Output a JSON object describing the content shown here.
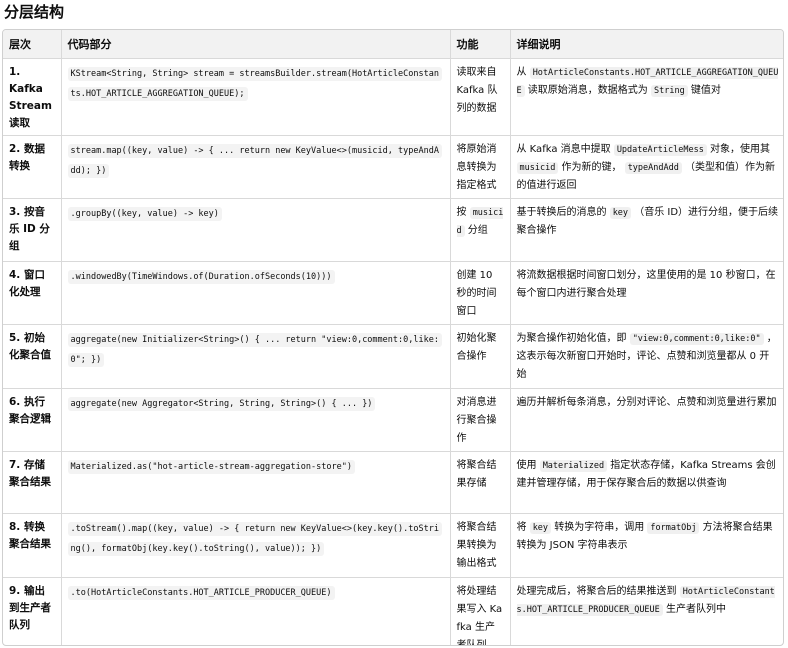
{
  "title": "分层结构",
  "headers": [
    "层次",
    "代码部分",
    "功能",
    "详细说明"
  ],
  "rows": [
    {
      "layer": "1. Kafka Stream 读取",
      "code": "KStream<String, String> stream = streamsBuilder.stream(HotArticleConstants.HOT_ARTICLE_AGGREGATION_QUEUE);",
      "func": "读取来自 Kafka 队列的数据",
      "detail": [
        {
          "t": "text",
          "v": "从 "
        },
        {
          "t": "code",
          "v": "HotArticleConstants.HOT_ARTICLE_AGGREGATION_QUEUE"
        },
        {
          "t": "text",
          "v": " 读取原始消息，数据格式为 "
        },
        {
          "t": "code",
          "v": "String"
        },
        {
          "t": "text",
          "v": " 键值对"
        }
      ]
    },
    {
      "layer": "2. 数据转换",
      "code": "stream.map((key, value) -> { ... return new KeyValue<>(musicid, typeAndAdd); })",
      "func": "将原始消息转换为指定格式",
      "detail": [
        {
          "t": "text",
          "v": "从 Kafka 消息中提取 "
        },
        {
          "t": "code",
          "v": "UpdateArticleMess"
        },
        {
          "t": "text",
          "v": " 对象，使用其 "
        },
        {
          "t": "code",
          "v": "musicid"
        },
        {
          "t": "text",
          "v": " 作为新的键， "
        },
        {
          "t": "code",
          "v": "typeAndAdd"
        },
        {
          "t": "text",
          "v": " （类型和值）作为新的值进行返回"
        }
      ]
    },
    {
      "layer": "3. 按音乐 ID 分组",
      "code": ".groupBy((key, value) -> key)",
      "func_parts": [
        {
          "t": "text",
          "v": "按 "
        },
        {
          "t": "code",
          "v": "musicid"
        },
        {
          "t": "text",
          "v": " 分组"
        }
      ],
      "detail": [
        {
          "t": "text",
          "v": "基于转换后的消息的 "
        },
        {
          "t": "code",
          "v": "key"
        },
        {
          "t": "text",
          "v": " （音乐 ID）进行分组，便于后续聚合操作"
        }
      ]
    },
    {
      "layer": "4. 窗口化处理",
      "code": ".windowedBy(TimeWindows.of(Duration.ofSeconds(10)))",
      "func": "创建 10 秒的时间窗口",
      "detail": [
        {
          "t": "text",
          "v": "将流数据根据时间窗口划分，这里使用的是 10 秒窗口，在每个窗口内进行聚合处理"
        }
      ]
    },
    {
      "layer": "5. 初始化聚合值",
      "code": "aggregate(new Initializer<String>() { ... return \"view:0,comment:0,like:0\"; })",
      "func": "初始化聚合操作",
      "detail": [
        {
          "t": "text",
          "v": "为聚合操作初始化值，即 "
        },
        {
          "t": "code",
          "v": "\"view:0,comment:0,like:0\""
        },
        {
          "t": "text",
          "v": " ，这表示每次新窗口开始时，评论、点赞和浏览量都从 0 开始"
        }
      ]
    },
    {
      "layer": "6. 执行聚合逻辑",
      "code": "aggregate(new Aggregator<String, String, String>() { ... })",
      "func": "对消息进行聚合操作",
      "detail": [
        {
          "t": "text",
          "v": "遍历并解析每条消息，分别对评论、点赞和浏览量进行累加"
        }
      ]
    },
    {
      "layer": "7. 存储聚合结果",
      "code": "Materialized.as(\"hot-article-stream-aggregation-store\")",
      "func": "将聚合结果存储",
      "detail": [
        {
          "t": "text",
          "v": "使用 "
        },
        {
          "t": "code",
          "v": "Materialized"
        },
        {
          "t": "text",
          "v": " 指定状态存储，Kafka Streams 会创建并管理存储，用于保存聚合后的数据以供查询"
        }
      ]
    },
    {
      "layer": "8. 转换聚合结果",
      "code": ".toStream().map((key, value) -> { return new KeyValue<>(key.key().toString(), formatObj(key.key().toString(), value)); })",
      "func": "将聚合结果转换为输出格式",
      "detail": [
        {
          "t": "text",
          "v": "将 "
        },
        {
          "t": "code",
          "v": "key"
        },
        {
          "t": "text",
          "v": " 转换为字符串，调用 "
        },
        {
          "t": "code",
          "v": "formatObj"
        },
        {
          "t": "text",
          "v": " 方法将聚合结果转换为 JSON 字符串表示"
        }
      ]
    },
    {
      "layer": "9. 输出到生产者队列",
      "code": ".to(HotArticleConstants.HOT_ARTICLE_PRODUCER_QUEUE)",
      "func": "将处理结果写入 Kafka 生产者队列",
      "detail": [
        {
          "t": "text",
          "v": "处理完成后，将聚合后的结果推送到 "
        },
        {
          "t": "code",
          "v": "HotArticleConstants.HOT_ARTICLE_PRODUCER_QUEUE"
        },
        {
          "t": "text",
          "v": " 生产者队列中"
        }
      ]
    }
  ]
}
